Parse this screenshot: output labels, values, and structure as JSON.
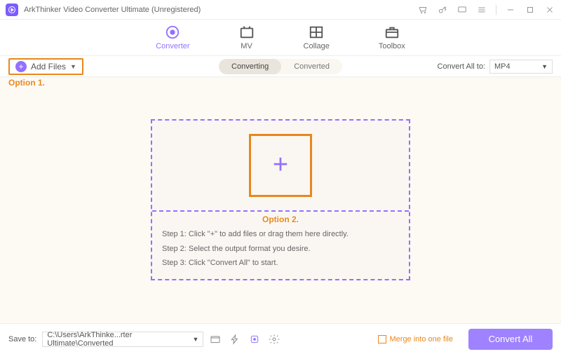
{
  "title": "ArkThinker Video Converter Ultimate (Unregistered)",
  "nav": {
    "converter": "Converter",
    "mv": "MV",
    "collage": "Collage",
    "toolbox": "Toolbox"
  },
  "addFiles": "Add Files",
  "annotations": {
    "option1": "Option 1.",
    "option2": "Option 2."
  },
  "segment": {
    "converting": "Converting",
    "converted": "Converted"
  },
  "convertAll": {
    "label": "Convert All to:",
    "value": "MP4"
  },
  "steps": {
    "s1": "Step 1: Click \"+\" to add files or drag them here directly.",
    "s2": "Step 2: Select the output format you desire.",
    "s3": "Step 3: Click \"Convert All\" to start."
  },
  "bottom": {
    "saveTo": "Save to:",
    "path": "C:\\Users\\ArkThinke...rter Ultimate\\Converted",
    "merge": "Merge into one file",
    "convertAll": "Convert All"
  }
}
